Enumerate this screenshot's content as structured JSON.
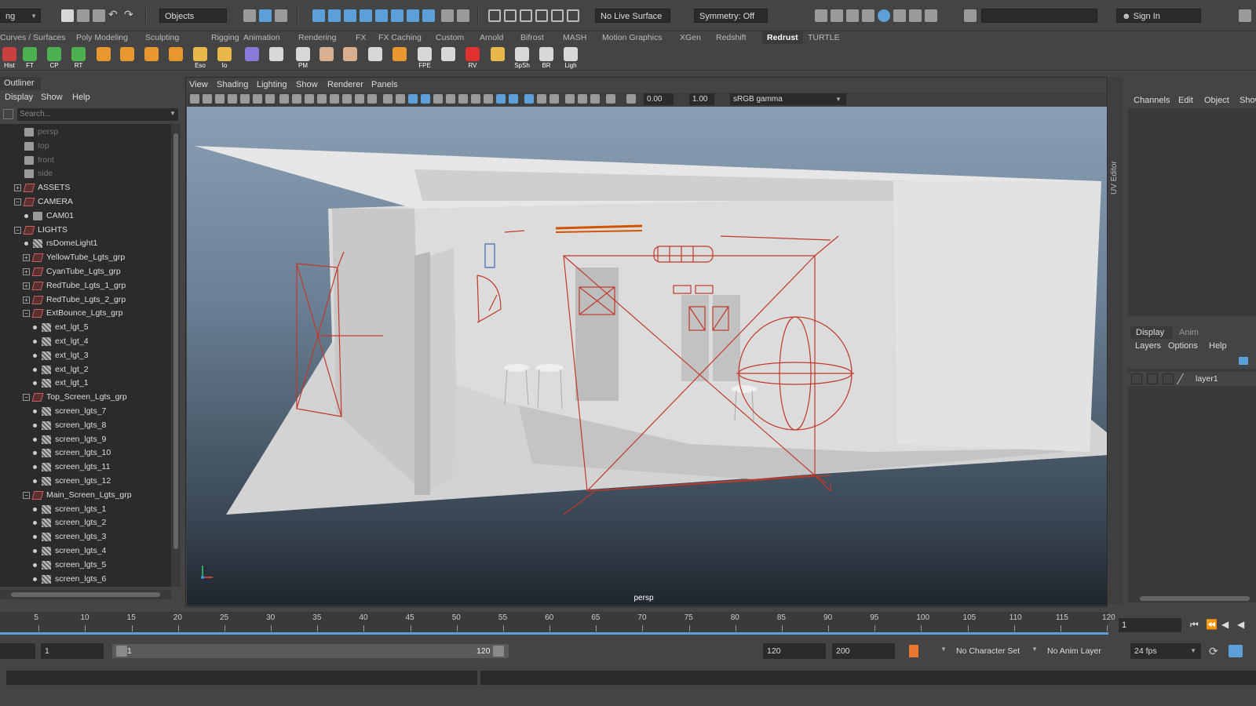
{
  "statusline": {
    "mode_menu": "ng",
    "selection_mask": "Objects",
    "live_surface": "No Live Surface",
    "symmetry": "Symmetry: Off",
    "sign_in": "Sign In"
  },
  "shelf_tabs": [
    "Curves / Surfaces",
    "Poly Modeling",
    "Sculpting",
    "Rigging",
    "Animation",
    "Rendering",
    "FX",
    "FX Caching",
    "Custom",
    "Arnold",
    "Bifrost",
    "MASH",
    "Motion Graphics",
    "XGen",
    "Redshift",
    "Redrust",
    "TURTLE"
  ],
  "shelf_active": "Redrust",
  "shelf_buttons": [
    {
      "label": "Hist",
      "color": "#c84040"
    },
    {
      "label": "FT",
      "color": "#4caf50"
    },
    {
      "label": "CP",
      "color": "#4caf50"
    },
    {
      "label": "RT",
      "color": "#4caf50"
    },
    {
      "label": "",
      "color": "#e8962e"
    },
    {
      "label": "",
      "color": "#e8962e"
    },
    {
      "label": "",
      "color": "#e8962e"
    },
    {
      "label": "",
      "color": "#e8962e"
    },
    {
      "label": "Eso",
      "color": "#e8b84a"
    },
    {
      "label": "Io",
      "color": "#e8b84a"
    },
    {
      "label": "",
      "color": "#8a7ad8"
    },
    {
      "label": "",
      "color": "#d8d8d8"
    },
    {
      "label": "PM",
      "color": "#d8d8d8"
    },
    {
      "label": "",
      "color": "#d8b090"
    },
    {
      "label": "",
      "color": "#d8b090"
    },
    {
      "label": "",
      "color": "#d8d8d8"
    },
    {
      "label": "",
      "color": "#e8962e"
    },
    {
      "label": "FPE",
      "color": "#d8d8d8"
    },
    {
      "label": "",
      "color": "#d8d8d8"
    },
    {
      "label": "RV",
      "color": "#e03030"
    },
    {
      "label": "",
      "color": "#e8b84a"
    },
    {
      "label": "SpSh",
      "color": "#d8d8d8"
    },
    {
      "label": "BR",
      "color": "#d8d8d8"
    },
    {
      "label": "Ligh",
      "color": "#d8d8d8"
    }
  ],
  "outliner": {
    "title": "Outliner",
    "menu": [
      "Display",
      "Show",
      "Help"
    ],
    "search_placeholder": "Search...",
    "rows": [
      {
        "label": "persp",
        "indent": 0,
        "icon": "cam",
        "expander": "",
        "dim": true
      },
      {
        "label": "top",
        "indent": 0,
        "icon": "cam",
        "expander": "",
        "dim": true
      },
      {
        "label": "front",
        "indent": 0,
        "icon": "cam",
        "expander": "",
        "dim": true
      },
      {
        "label": "side",
        "indent": 0,
        "icon": "cam",
        "expander": "",
        "dim": true
      },
      {
        "label": "ASSETS",
        "indent": 0,
        "icon": "grp",
        "expander": "+",
        "dim": false
      },
      {
        "label": "CAMERA",
        "indent": 0,
        "icon": "grp",
        "expander": "−",
        "dim": false
      },
      {
        "label": "CAM01",
        "indent": 1,
        "icon": "cam",
        "expander": "",
        "dim": false
      },
      {
        "label": "LIGHTS",
        "indent": 0,
        "icon": "grp",
        "expander": "−",
        "dim": false
      },
      {
        "label": "rsDomeLight1",
        "indent": 1,
        "icon": "lgt",
        "expander": "",
        "dim": false
      },
      {
        "label": "YellowTube_Lgts_grp",
        "indent": 1,
        "icon": "grp",
        "expander": "+",
        "dim": false
      },
      {
        "label": "CyanTube_Lgts_grp",
        "indent": 1,
        "icon": "grp",
        "expander": "+",
        "dim": false
      },
      {
        "label": "RedTube_Lgts_1_grp",
        "indent": 1,
        "icon": "grp",
        "expander": "+",
        "dim": false
      },
      {
        "label": "RedTube_Lgts_2_grp",
        "indent": 1,
        "icon": "grp",
        "expander": "+",
        "dim": false
      },
      {
        "label": "ExtBounce_Lgts_grp",
        "indent": 1,
        "icon": "grp",
        "expander": "−",
        "dim": false
      },
      {
        "label": "ext_lgt_5",
        "indent": 2,
        "icon": "lgt",
        "expander": "",
        "dim": false
      },
      {
        "label": "ext_lgt_4",
        "indent": 2,
        "icon": "lgt",
        "expander": "",
        "dim": false
      },
      {
        "label": "ext_lgt_3",
        "indent": 2,
        "icon": "lgt",
        "expander": "",
        "dim": false
      },
      {
        "label": "ext_lgt_2",
        "indent": 2,
        "icon": "lgt",
        "expander": "",
        "dim": false
      },
      {
        "label": "ext_lgt_1",
        "indent": 2,
        "icon": "lgt",
        "expander": "",
        "dim": false
      },
      {
        "label": "Top_Screen_Lgts_grp",
        "indent": 1,
        "icon": "grp",
        "expander": "−",
        "dim": false
      },
      {
        "label": "screen_lgts_7",
        "indent": 2,
        "icon": "lgt",
        "expander": "",
        "dim": false
      },
      {
        "label": "screen_lgts_8",
        "indent": 2,
        "icon": "lgt",
        "expander": "",
        "dim": false
      },
      {
        "label": "screen_lgts_9",
        "indent": 2,
        "icon": "lgt",
        "expander": "",
        "dim": false
      },
      {
        "label": "screen_lgts_10",
        "indent": 2,
        "icon": "lgt",
        "expander": "",
        "dim": false
      },
      {
        "label": "screen_lgts_11",
        "indent": 2,
        "icon": "lgt",
        "expander": "",
        "dim": false
      },
      {
        "label": "screen_lgts_12",
        "indent": 2,
        "icon": "lgt",
        "expander": "",
        "dim": false
      },
      {
        "label": "Main_Screen_Lgts_grp",
        "indent": 1,
        "icon": "grp",
        "expander": "−",
        "dim": false
      },
      {
        "label": "screen_lgts_1",
        "indent": 2,
        "icon": "lgt",
        "expander": "",
        "dim": false
      },
      {
        "label": "screen_lgts_2",
        "indent": 2,
        "icon": "lgt",
        "expander": "",
        "dim": false
      },
      {
        "label": "screen_lgts_3",
        "indent": 2,
        "icon": "lgt",
        "expander": "",
        "dim": false
      },
      {
        "label": "screen_lgts_4",
        "indent": 2,
        "icon": "lgt",
        "expander": "",
        "dim": false
      },
      {
        "label": "screen_lgts_5",
        "indent": 2,
        "icon": "lgt",
        "expander": "",
        "dim": false
      },
      {
        "label": "screen_lgts_6",
        "indent": 2,
        "icon": "lgt",
        "expander": "",
        "dim": false
      }
    ]
  },
  "viewport": {
    "menu": [
      "View",
      "Shading",
      "Lighting",
      "Show",
      "Renderer",
      "Panels"
    ],
    "field_a": "0.00",
    "field_b": "1.00",
    "color_space": "sRGB gamma",
    "camera_label": "persp"
  },
  "side_tab": "UV Editor",
  "channel_box": {
    "menu": [
      "Channels",
      "Edit",
      "Object",
      "Show"
    ]
  },
  "layer_editor": {
    "tabs": [
      "Display",
      "Anim"
    ],
    "active_tab": "Display",
    "menu": [
      "Layers",
      "Options",
      "Help"
    ],
    "layer_name": "layer1"
  },
  "timeline": {
    "ticks": [
      "5",
      "10",
      "15",
      "20",
      "25",
      "30",
      "35",
      "40",
      "45",
      "50",
      "55",
      "60",
      "65",
      "70",
      "75",
      "80",
      "85",
      "90",
      "95",
      "100",
      "105",
      "110",
      "115",
      "120"
    ],
    "current_frame": "1"
  },
  "range": {
    "start_time": "1",
    "range_start": "1",
    "range_end": "120",
    "end_time": "120",
    "anim_end": "200",
    "character_set": "No Character Set",
    "anim_layer": "No Anim Layer",
    "fps": "24 fps"
  },
  "colors": {
    "accent": "#5da0d8",
    "light_wire": "#c0392b",
    "panel_bg": "#444444",
    "field_bg": "#2b2b2b"
  }
}
